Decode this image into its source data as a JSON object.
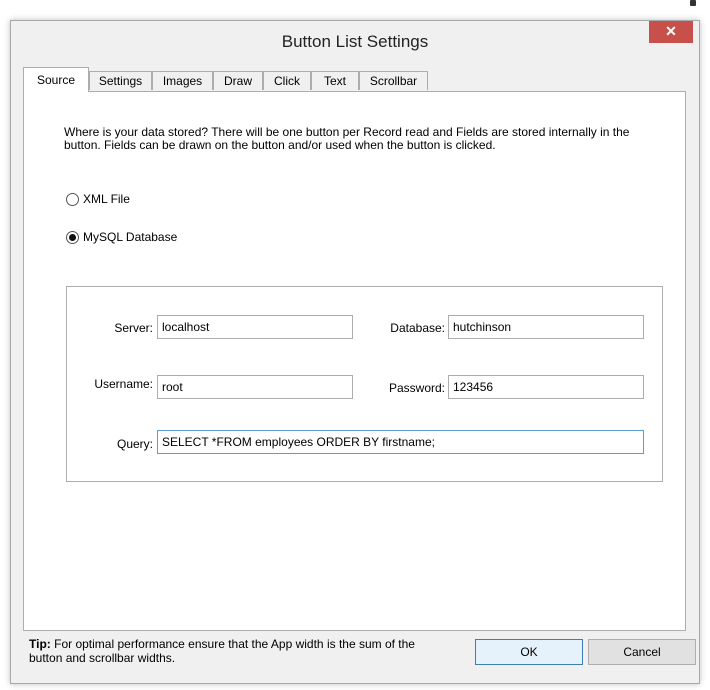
{
  "window": {
    "title": "Button List Settings",
    "close_glyph": "✕"
  },
  "tabs": [
    {
      "label": "Source",
      "active": true
    },
    {
      "label": "Settings"
    },
    {
      "label": "Images"
    },
    {
      "label": "Draw"
    },
    {
      "label": "Click"
    },
    {
      "label": "Text"
    },
    {
      "label": "Scrollbar"
    }
  ],
  "source": {
    "description": "Where is your data stored? There will be one button per Record read and Fields are stored internally in the button. Fields can be drawn on the button and/or used when the button is clicked.",
    "options": [
      {
        "label": "XML File",
        "checked": false
      },
      {
        "label": "MySQL Database",
        "checked": true
      }
    ]
  },
  "db": {
    "server_label": "Server:",
    "server_value": "localhost",
    "database_label": "Database:",
    "database_value": "hutchinson",
    "username_label": "Username:",
    "username_value": "root",
    "password_label": "Password:",
    "password_value": "123456",
    "query_label": "Query:",
    "query_value": "SELECT *FROM employees ORDER BY firstname;"
  },
  "footer": {
    "tip_label": "Tip:",
    "tip_text": "For optimal performance ensure that the App width is the sum of the button and scrollbar widths.",
    "ok_label": "OK",
    "cancel_label": "Cancel"
  }
}
